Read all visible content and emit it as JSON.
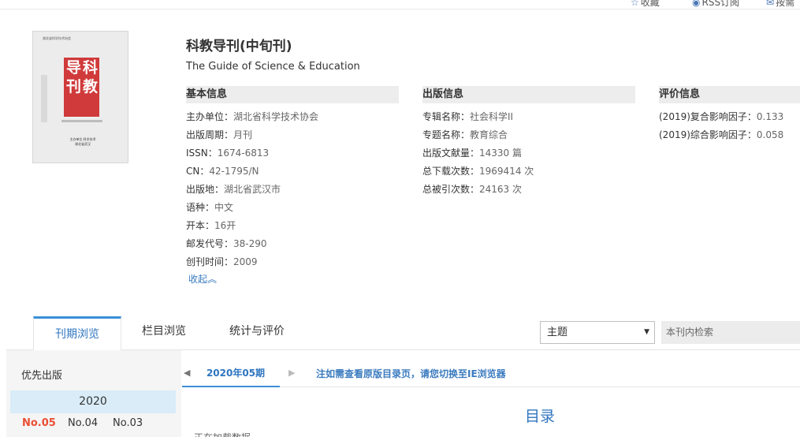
{
  "topbar": {
    "favorite": "收藏",
    "rss": "RSS订阅",
    "subscribe": "按需"
  },
  "cover": {
    "top_text": "湖北省科学技术协会",
    "seal_chars": [
      "导",
      "科",
      "刊",
      "教"
    ],
    "bottom_text": "主办单位 科学技术 湖北省武汉"
  },
  "journal": {
    "title": "科教导刊(中旬刊)",
    "subtitle": "The Guide of Science & Education"
  },
  "basic": {
    "heading": "基本信息",
    "rows": [
      {
        "label": "主办单位：",
        "value": "湖北省科学技术协会"
      },
      {
        "label": "出版周期：",
        "value": "月刊"
      },
      {
        "label": "ISSN：",
        "value": "1674-6813"
      },
      {
        "label": "CN：",
        "value": "42-1795/N"
      },
      {
        "label": "出版地：",
        "value": "湖北省武汉市"
      },
      {
        "label": "语种：",
        "value": "中文"
      },
      {
        "label": "开本：",
        "value": "16开"
      },
      {
        "label": "邮发代号：",
        "value": "38-290"
      },
      {
        "label": "创刊时间：",
        "value": "2009"
      }
    ],
    "collapse": "收起︽"
  },
  "publication": {
    "heading": "出版信息",
    "rows": [
      {
        "label": "专辑名称：",
        "value": "社会科学II"
      },
      {
        "label": "专题名称：",
        "value": "教育综合"
      },
      {
        "label": "出版文献量：",
        "value": "14330 篇"
      },
      {
        "label": "总下载次数：",
        "value": "1969414 次"
      },
      {
        "label": "总被引次数：",
        "value": "24163 次"
      }
    ]
  },
  "evaluation": {
    "heading": "评价信息",
    "rows": [
      {
        "label": "(2019)复合影响因子：",
        "value": "0.133"
      },
      {
        "label": "(2019)综合影响因子：",
        "value": "0.058"
      }
    ]
  },
  "tabs": [
    {
      "label": "刊期浏览"
    },
    {
      "label": "栏目浏览"
    },
    {
      "label": "统计与评价"
    }
  ],
  "search": {
    "select_value": "主题",
    "placeholder": "本刊内检索"
  },
  "left": {
    "priority": "优先出版",
    "year": "2020",
    "issues": [
      "No.05",
      "No.04",
      "No.03"
    ]
  },
  "content": {
    "current_issue": "2020年05期",
    "ie_note": "注如需查看原版目录页，请您切换至IE浏览器",
    "toc_title": "目录",
    "loading": "正在加载数据..."
  }
}
